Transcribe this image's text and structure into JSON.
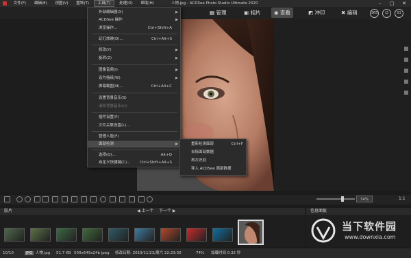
{
  "menubar": {
    "items": [
      "文件(F)",
      "编辑(E)",
      "视图(V)",
      "整饰(T)",
      "工具(T)",
      "处理(O)",
      "帮助(H)"
    ],
    "active_index": 4
  },
  "window": {
    "title": "人物.jpg - ACDSee Photo Studio Ultimate 2020"
  },
  "modes": {
    "manage": "管理",
    "photos": "相片",
    "view": "查看",
    "develop": "冲印",
    "edit": "编辑"
  },
  "mode_circles": [
    "365",
    "☺",
    "01"
  ],
  "tools_menu": {
    "items": [
      {
        "label": "外部编辑器(X)",
        "shortcut": "",
        "arrow": true
      },
      {
        "label": "ACDSee 操作",
        "shortcut": "",
        "arrow": true
      },
      {
        "label": "浏览操作...",
        "shortcut": "Ctrl+Shift+A",
        "arrow": false
      },
      {
        "label": "幻灯放映(D)...",
        "shortcut": "Ctrl+Alt+S",
        "arrow": false
      },
      {
        "label": "修改(Y)",
        "shortcut": "",
        "arrow": true
      },
      {
        "label": "旋转(Z)",
        "shortcut": "",
        "arrow": true
      },
      {
        "label": "图像音频(I)",
        "shortcut": "",
        "arrow": true
      },
      {
        "label": "设为墙纸(W)",
        "shortcut": "",
        "arrow": true
      },
      {
        "label": "屏幕截图(N)...",
        "shortcut": "Ctrl+Alt+C",
        "arrow": false
      },
      {
        "label": "设置背景音乐(S)",
        "shortcut": "",
        "arrow": false
      },
      {
        "label": "清除背景音乐(U)",
        "shortcut": "",
        "arrow": false
      },
      {
        "label": "插件设置(P)",
        "shortcut": "",
        "arrow": false
      },
      {
        "label": "文件关联设置(L)...",
        "shortcut": "",
        "arrow": false
      },
      {
        "label": "管理人脸(F)",
        "shortcut": "",
        "arrow": false
      },
      {
        "label": "面部检测",
        "shortcut": "",
        "arrow": true
      },
      {
        "label": "选项(O)...",
        "shortcut": "Alt+O",
        "arrow": false
      },
      {
        "label": "自定义快捷键(C)...",
        "shortcut": "Ctrl+Shift+Alt+S",
        "arrow": false
      }
    ]
  },
  "face_menu": {
    "items": [
      {
        "label": "重新检测面部",
        "shortcut": "Ctrl+F"
      },
      {
        "label": "去除面部数据",
        "shortcut": ""
      },
      {
        "label": "再次识别",
        "shortcut": ""
      },
      {
        "label": "导入 ACDSee 面部数据",
        "shortcut": ""
      }
    ]
  },
  "toolbar": {
    "zoom": "74%",
    "ratio": "1:1"
  },
  "filmstrip": {
    "title": "胶片",
    "prev": "上一个",
    "next": "下一个",
    "info_title": "信息面板"
  },
  "thumbnails": [
    "#4f6a4a",
    "#5c7246",
    "#3c6a42",
    "#3f6b3a",
    "#2f5a66",
    "#3f7aa0",
    "#b4472a",
    "#c92a2a",
    "#0f6ea0",
    "#8a5a4a"
  ],
  "statusbar": {
    "index": "10/10",
    "format": "JPG",
    "filename": "人物.jpg",
    "size": "51.7 KB",
    "dims": "500x649x24b jpeg",
    "date": "修改日期: 2019/11/23/周六 22:23:30",
    "zoom": "74%",
    "loadtime": "加载时间 0.32 秒"
  },
  "watermark": {
    "brand": "当下软件园",
    "url": "www.downxia.com"
  }
}
